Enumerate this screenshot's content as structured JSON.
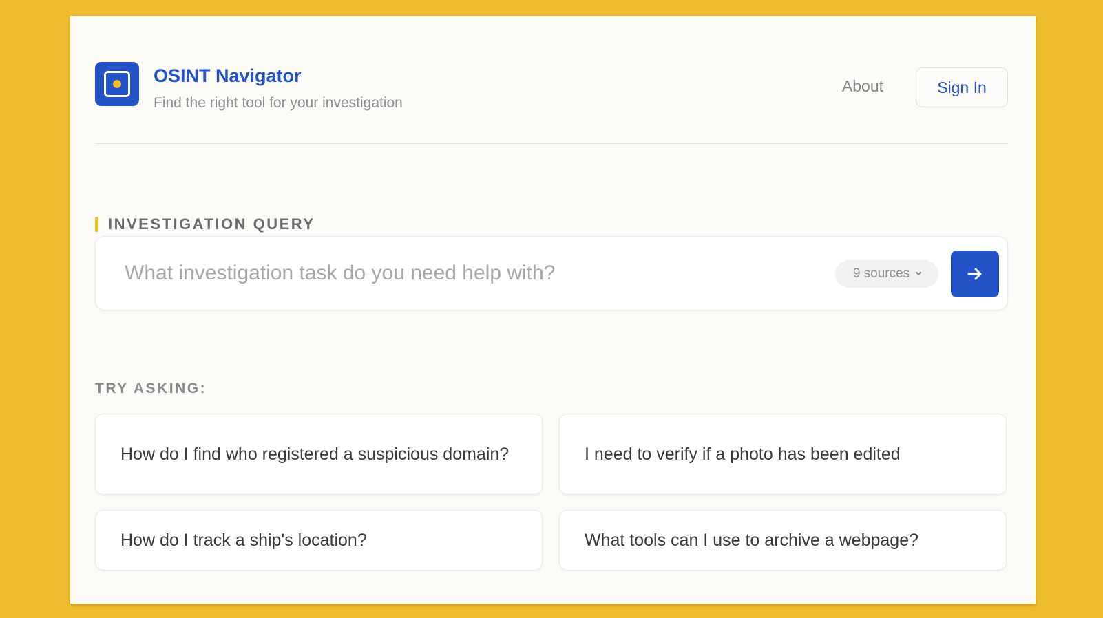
{
  "header": {
    "logo_icon": "target-square-icon",
    "title": "OSINT Navigator",
    "subtitle": "Find the right tool for your investigation",
    "about_label": "About",
    "signin_label": "Sign In"
  },
  "query": {
    "section_label": "INVESTIGATION QUERY",
    "placeholder": "What investigation task do you need help with?",
    "value": "",
    "sources_label": "9 sources",
    "submit_icon": "arrow-right-icon"
  },
  "suggestions": {
    "label": "TRY ASKING:",
    "items": [
      "How do I find who registered a suspicious domain?",
      "I need to verify if a photo has been edited",
      "How do I track a ship's location?",
      "What tools can I use to archive a webpage?"
    ]
  },
  "colors": {
    "background": "#EFBC2F",
    "accent": "#2453C7",
    "highlight": "#EFBC2F",
    "panel": "#FCFBF8"
  }
}
